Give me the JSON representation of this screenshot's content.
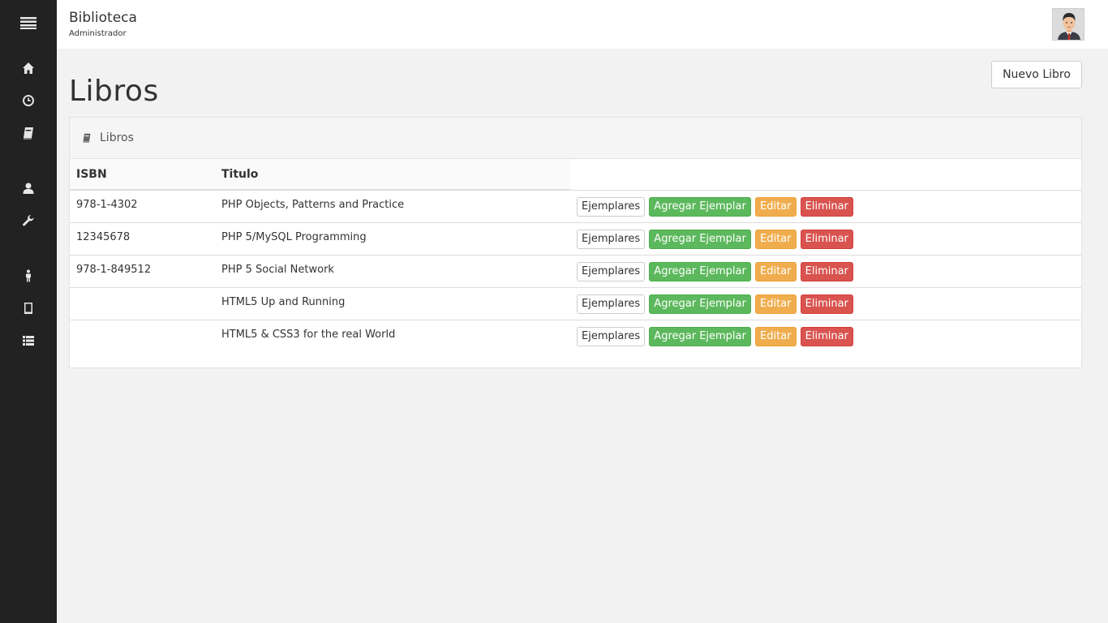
{
  "app": {
    "title": "Biblioteca",
    "subtitle": "Administrador"
  },
  "sidebar": {
    "items": [
      {
        "icon": "menu-icon"
      },
      {
        "icon": "home-icon"
      },
      {
        "icon": "clock-icon"
      },
      {
        "icon": "book-icon"
      },
      {
        "icon": "user-icon"
      },
      {
        "icon": "wrench-icon"
      },
      {
        "icon": "person-icon"
      },
      {
        "icon": "tablet-icon"
      },
      {
        "icon": "list-icon"
      }
    ]
  },
  "page": {
    "title": "Libros",
    "new_button": "Nuevo Libro"
  },
  "panel": {
    "heading": "Libros"
  },
  "table": {
    "columns": [
      "ISBN",
      "Titulo"
    ],
    "action_labels": {
      "copies": "Ejemplares",
      "add_copy": "Agregar Ejemplar",
      "edit": "Editar",
      "delete": "Eliminar"
    },
    "rows": [
      {
        "isbn": "978-1-4302",
        "title": "PHP Objects, Patterns and Practice"
      },
      {
        "isbn": "12345678",
        "title": "PHP 5/MySQL Programming"
      },
      {
        "isbn": "978-1-849512",
        "title": "PHP 5 Social Network"
      },
      {
        "isbn": "",
        "title": "HTML5 Up and Running"
      },
      {
        "isbn": "",
        "title": "HTML5 & CSS3 for the real World"
      }
    ]
  },
  "colors": {
    "sidebar_bg": "#222222",
    "success": "#5cb85c",
    "warning": "#f0ad4e",
    "danger": "#d9534f"
  }
}
